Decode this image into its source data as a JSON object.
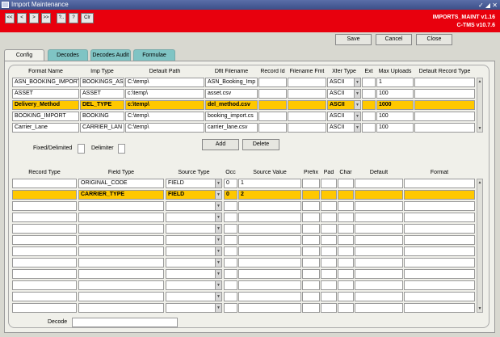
{
  "window": {
    "title": "Import Maintenance"
  },
  "app": {
    "name": "IMPORTS_MAINT v1.16",
    "product": "C-TMS v10.7.6"
  },
  "nav_buttons": [
    "<<",
    "<",
    ">",
    ">>",
    "?..",
    "?",
    "Clr"
  ],
  "commands": {
    "save": "Save",
    "cancel": "Cancel",
    "close": "Close"
  },
  "tabs": [
    "Config",
    "Decodes",
    "Decodes Audit",
    "Formulae"
  ],
  "upper": {
    "headers": [
      "Format Name",
      "Imp Type",
      "Default Path",
      "Dflt Filename",
      "Record Id",
      "Filename Fmt",
      "Xfer Type",
      "Ext",
      "Max Uploads",
      "Default Record Type"
    ],
    "rows": [
      {
        "format_name": "ASN_BOOKING_IMPORT",
        "imp_type": "BOOKINGS_AS",
        "path": "C:\\temp\\",
        "filename": "ASN_Booking_Imp",
        "record_id": "",
        "filename_fmt": "",
        "xfer": "ASCII",
        "ext": "",
        "max": "1",
        "default_type": ""
      },
      {
        "format_name": "ASSET",
        "imp_type": "ASSET",
        "path": "c:\\temp\\",
        "filename": "asset.csv",
        "record_id": "",
        "filename_fmt": "",
        "xfer": "ASCII",
        "ext": "",
        "max": "100",
        "default_type": ""
      },
      {
        "format_name": "Delivery_Method",
        "imp_type": "DEL_TYPE",
        "path": "c:\\temp\\",
        "filename": "del_method.csv",
        "record_id": "",
        "filename_fmt": "",
        "xfer": "ASCII",
        "ext": "",
        "max": "1000",
        "default_type": ""
      },
      {
        "format_name": "BOOKING_IMPORT",
        "imp_type": "BOOKING",
        "path": "C:\\temp\\",
        "filename": "booking_import.cs",
        "record_id": "",
        "filename_fmt": "",
        "xfer": "ASCII",
        "ext": "",
        "max": "100",
        "default_type": ""
      },
      {
        "format_name": "Carrier_Lane",
        "imp_type": "CARRIER_LAN",
        "path": "C:\\temp\\",
        "filename": "carrier_lane.csv",
        "record_id": "",
        "filename_fmt": "",
        "xfer": "ASCII",
        "ext": "",
        "max": "100",
        "default_type": ""
      }
    ]
  },
  "controls": {
    "fixed_delimited": "Fixed/Delimited",
    "delimiter": "Delimiter",
    "add": "Add",
    "delete": "Delete"
  },
  "lower": {
    "headers": [
      "Record Type",
      "Field Type",
      "Source Type",
      "Occ",
      "Source Value",
      "Prefix",
      "Pad",
      "Char",
      "Default",
      "Format"
    ],
    "rows": [
      {
        "record_type": "",
        "field_type": "ORIGINAL_CODE",
        "source_type": "FIELD",
        "occ": "0",
        "source_value": "1"
      },
      {
        "record_type": "",
        "field_type": "CARRIER_TYPE",
        "source_type": "FIELD",
        "occ": "0",
        "source_value": "2"
      }
    ]
  },
  "decode": {
    "label": "Decode",
    "value": ""
  }
}
